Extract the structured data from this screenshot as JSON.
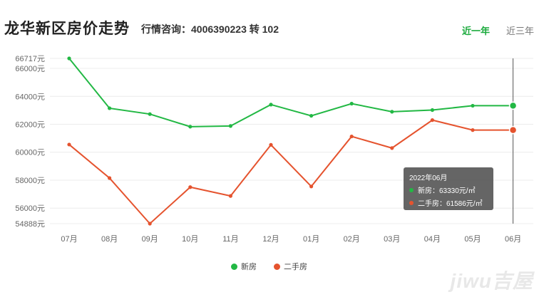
{
  "header": {
    "title": "龙华新区房价走势",
    "hotline": "行情咨询：4006390223 转 102",
    "tabs": [
      {
        "label": "近一年",
        "active": true
      },
      {
        "label": "近三年",
        "active": false
      }
    ]
  },
  "chart_data": {
    "type": "line",
    "categories": [
      "07月",
      "08月",
      "09月",
      "10月",
      "11月",
      "12月",
      "01月",
      "02月",
      "03月",
      "04月",
      "05月",
      "06月"
    ],
    "series": [
      {
        "name": "新房",
        "color": "#22b844",
        "values": [
          66717,
          63150,
          62730,
          61830,
          61880,
          63410,
          62610,
          63480,
          62900,
          63020,
          63330,
          63330
        ]
      },
      {
        "name": "二手房",
        "color": "#e5532e",
        "values": [
          60550,
          58150,
          54888,
          57500,
          56870,
          60530,
          57550,
          61130,
          60300,
          62300,
          61586,
          61586
        ]
      }
    ],
    "yticks": [
      54888,
      56000,
      58000,
      60000,
      62000,
      64000,
      66000,
      66717
    ],
    "ytick_labels": [
      "54888元",
      "56000元",
      "58000元",
      "60000元",
      "62000元",
      "64000元",
      "66000元",
      "66717元"
    ],
    "ylim": [
      54888,
      66717
    ],
    "grid": true,
    "legend_position": "bottom",
    "highlight_index": 11,
    "tooltip": {
      "title": "2022年06月",
      "rows": [
        {
          "text": "新房：63330元/㎡",
          "color": "#22b844"
        },
        {
          "text": "二手房：61586元/㎡",
          "color": "#e5532e"
        }
      ]
    }
  },
  "legend": [
    {
      "label": "新房",
      "color": "#22b844"
    },
    {
      "label": "二手房",
      "color": "#e5532e"
    }
  ],
  "watermark": "jiwu吉屋"
}
